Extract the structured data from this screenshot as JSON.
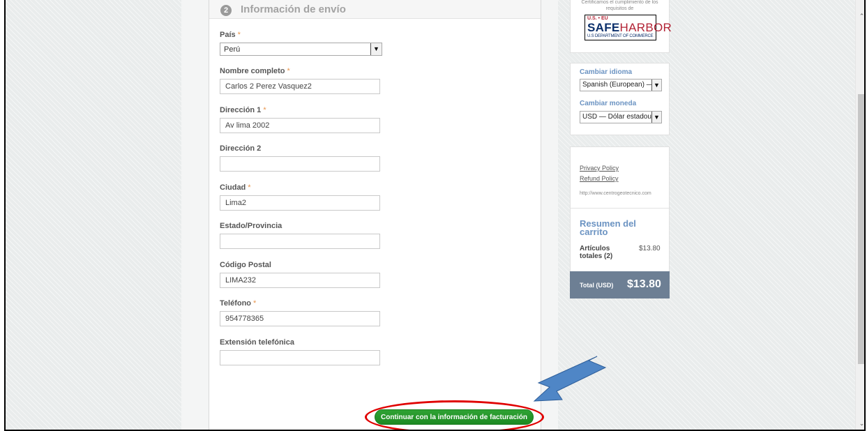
{
  "section": {
    "step_number": "2",
    "title": "Información de envío"
  },
  "form": {
    "required_marker": "*",
    "country": {
      "label": "País",
      "value": "Perú"
    },
    "full_name": {
      "label": "Nombre completo",
      "value": "Carlos 2 Perez Vasquez2"
    },
    "address1": {
      "label": "Dirección 1",
      "value": "Av lima 2002"
    },
    "address2": {
      "label": "Dirección 2",
      "value": ""
    },
    "city": {
      "label": "Ciudad",
      "value": "Lima2"
    },
    "state": {
      "label": "Estado/Provincia",
      "value": ""
    },
    "postal_code": {
      "label": "Código Postal",
      "value": "LIMA232"
    },
    "phone": {
      "label": "Teléfono",
      "value": "954778365"
    },
    "phone_ext": {
      "label": "Extensión telefónica",
      "value": ""
    },
    "continue_label": "Continuar con la información de facturación"
  },
  "sidebar": {
    "safeharbor": {
      "caption_line1": "Certificamos el cumplimiento de los",
      "caption_line2": "requisitos de",
      "logo_top": "U.S. • EU",
      "logo_safe": "SAFE",
      "logo_harbor": "HARBOR",
      "logo_bottom": "U.S DEPARTMENT OF COMMERCE"
    },
    "language": {
      "label": "Cambiar idioma",
      "value": "Spanish (European) —"
    },
    "currency": {
      "label": "Cambiar moneda",
      "value": "USD — Dólar estadoun"
    },
    "links": {
      "privacy": "Privacy Policy",
      "refund": "Refund Policy",
      "url": "http://www.centrogeotecnico.com"
    },
    "cart": {
      "title": "Resumen del carrito",
      "items_label": "Artículos totales (2)",
      "items_value": "$13.80",
      "total_label": "Total (USD)",
      "total_value": "$13.80"
    }
  },
  "colors": {
    "accent": "#6b93c2",
    "button": "#1d8a23",
    "highlight": "#e00000",
    "arrow": "#4f86c6"
  }
}
